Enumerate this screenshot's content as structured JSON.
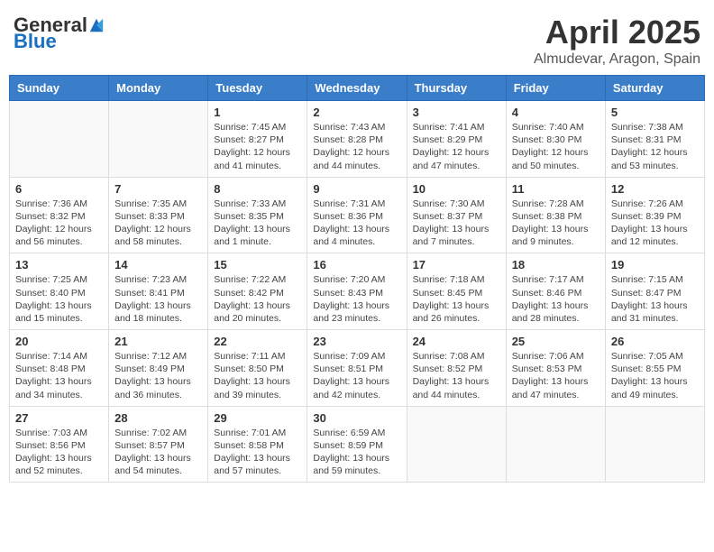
{
  "logo": {
    "general": "General",
    "blue": "Blue"
  },
  "title": "April 2025",
  "subtitle": "Almudevar, Aragon, Spain",
  "days_of_week": [
    "Sunday",
    "Monday",
    "Tuesday",
    "Wednesday",
    "Thursday",
    "Friday",
    "Saturday"
  ],
  "weeks": [
    [
      {
        "day": "",
        "info": ""
      },
      {
        "day": "",
        "info": ""
      },
      {
        "day": "1",
        "sunrise": "7:45 AM",
        "sunset": "8:27 PM",
        "daylight": "12 hours and 41 minutes."
      },
      {
        "day": "2",
        "sunrise": "7:43 AM",
        "sunset": "8:28 PM",
        "daylight": "12 hours and 44 minutes."
      },
      {
        "day": "3",
        "sunrise": "7:41 AM",
        "sunset": "8:29 PM",
        "daylight": "12 hours and 47 minutes."
      },
      {
        "day": "4",
        "sunrise": "7:40 AM",
        "sunset": "8:30 PM",
        "daylight": "12 hours and 50 minutes."
      },
      {
        "day": "5",
        "sunrise": "7:38 AM",
        "sunset": "8:31 PM",
        "daylight": "12 hours and 53 minutes."
      }
    ],
    [
      {
        "day": "6",
        "sunrise": "7:36 AM",
        "sunset": "8:32 PM",
        "daylight": "12 hours and 56 minutes."
      },
      {
        "day": "7",
        "sunrise": "7:35 AM",
        "sunset": "8:33 PM",
        "daylight": "12 hours and 58 minutes."
      },
      {
        "day": "8",
        "sunrise": "7:33 AM",
        "sunset": "8:35 PM",
        "daylight": "13 hours and 1 minute."
      },
      {
        "day": "9",
        "sunrise": "7:31 AM",
        "sunset": "8:36 PM",
        "daylight": "13 hours and 4 minutes."
      },
      {
        "day": "10",
        "sunrise": "7:30 AM",
        "sunset": "8:37 PM",
        "daylight": "13 hours and 7 minutes."
      },
      {
        "day": "11",
        "sunrise": "7:28 AM",
        "sunset": "8:38 PM",
        "daylight": "13 hours and 9 minutes."
      },
      {
        "day": "12",
        "sunrise": "7:26 AM",
        "sunset": "8:39 PM",
        "daylight": "13 hours and 12 minutes."
      }
    ],
    [
      {
        "day": "13",
        "sunrise": "7:25 AM",
        "sunset": "8:40 PM",
        "daylight": "13 hours and 15 minutes."
      },
      {
        "day": "14",
        "sunrise": "7:23 AM",
        "sunset": "8:41 PM",
        "daylight": "13 hours and 18 minutes."
      },
      {
        "day": "15",
        "sunrise": "7:22 AM",
        "sunset": "8:42 PM",
        "daylight": "13 hours and 20 minutes."
      },
      {
        "day": "16",
        "sunrise": "7:20 AM",
        "sunset": "8:43 PM",
        "daylight": "13 hours and 23 minutes."
      },
      {
        "day": "17",
        "sunrise": "7:18 AM",
        "sunset": "8:45 PM",
        "daylight": "13 hours and 26 minutes."
      },
      {
        "day": "18",
        "sunrise": "7:17 AM",
        "sunset": "8:46 PM",
        "daylight": "13 hours and 28 minutes."
      },
      {
        "day": "19",
        "sunrise": "7:15 AM",
        "sunset": "8:47 PM",
        "daylight": "13 hours and 31 minutes."
      }
    ],
    [
      {
        "day": "20",
        "sunrise": "7:14 AM",
        "sunset": "8:48 PM",
        "daylight": "13 hours and 34 minutes."
      },
      {
        "day": "21",
        "sunrise": "7:12 AM",
        "sunset": "8:49 PM",
        "daylight": "13 hours and 36 minutes."
      },
      {
        "day": "22",
        "sunrise": "7:11 AM",
        "sunset": "8:50 PM",
        "daylight": "13 hours and 39 minutes."
      },
      {
        "day": "23",
        "sunrise": "7:09 AM",
        "sunset": "8:51 PM",
        "daylight": "13 hours and 42 minutes."
      },
      {
        "day": "24",
        "sunrise": "7:08 AM",
        "sunset": "8:52 PM",
        "daylight": "13 hours and 44 minutes."
      },
      {
        "day": "25",
        "sunrise": "7:06 AM",
        "sunset": "8:53 PM",
        "daylight": "13 hours and 47 minutes."
      },
      {
        "day": "26",
        "sunrise": "7:05 AM",
        "sunset": "8:55 PM",
        "daylight": "13 hours and 49 minutes."
      }
    ],
    [
      {
        "day": "27",
        "sunrise": "7:03 AM",
        "sunset": "8:56 PM",
        "daylight": "13 hours and 52 minutes."
      },
      {
        "day": "28",
        "sunrise": "7:02 AM",
        "sunset": "8:57 PM",
        "daylight": "13 hours and 54 minutes."
      },
      {
        "day": "29",
        "sunrise": "7:01 AM",
        "sunset": "8:58 PM",
        "daylight": "13 hours and 57 minutes."
      },
      {
        "day": "30",
        "sunrise": "6:59 AM",
        "sunset": "8:59 PM",
        "daylight": "13 hours and 59 minutes."
      },
      {
        "day": "",
        "info": ""
      },
      {
        "day": "",
        "info": ""
      },
      {
        "day": "",
        "info": ""
      }
    ]
  ],
  "labels": {
    "sunrise": "Sunrise:",
    "sunset": "Sunset:",
    "daylight": "Daylight:"
  }
}
